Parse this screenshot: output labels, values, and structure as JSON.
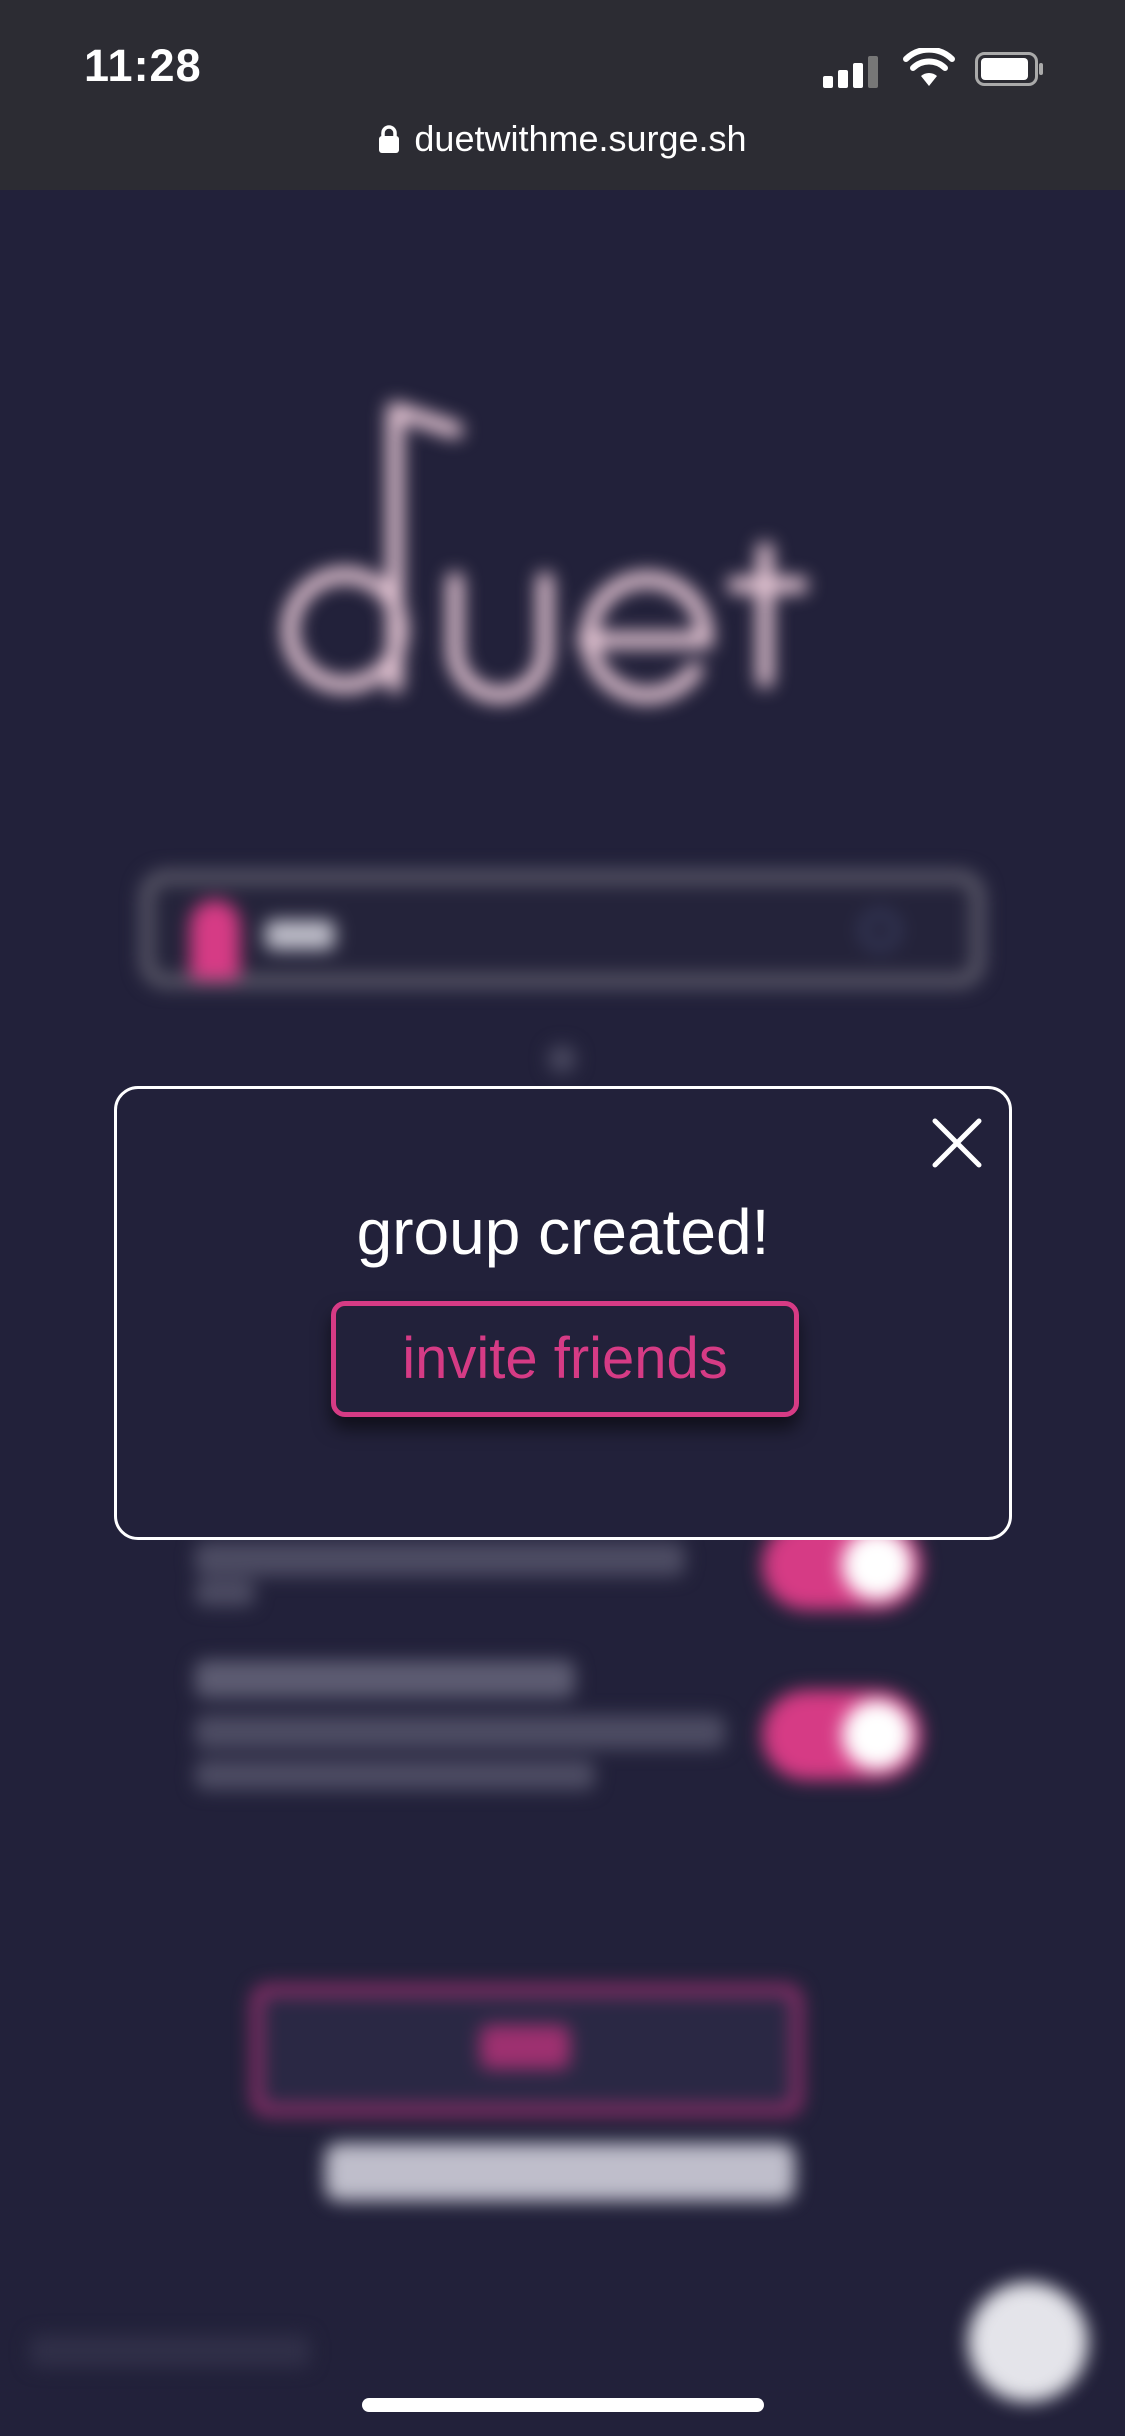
{
  "status_bar": {
    "time": "11:28",
    "url": "duetwithme.surge.sh",
    "icons": [
      "signal-icon",
      "wifi-icon",
      "battery-icon",
      "lock-icon"
    ]
  },
  "background": {
    "logo_text": "duet",
    "accent_color": "#d63b85",
    "toggles": [
      {
        "state": "on"
      },
      {
        "state": "on"
      }
    ]
  },
  "modal": {
    "title": "group created!",
    "invite_button_label": "invite friends",
    "close_icon": "close-icon"
  },
  "colors": {
    "background": "#22213a",
    "accent": "#d63b85",
    "status_bar": "#2c2c33"
  }
}
